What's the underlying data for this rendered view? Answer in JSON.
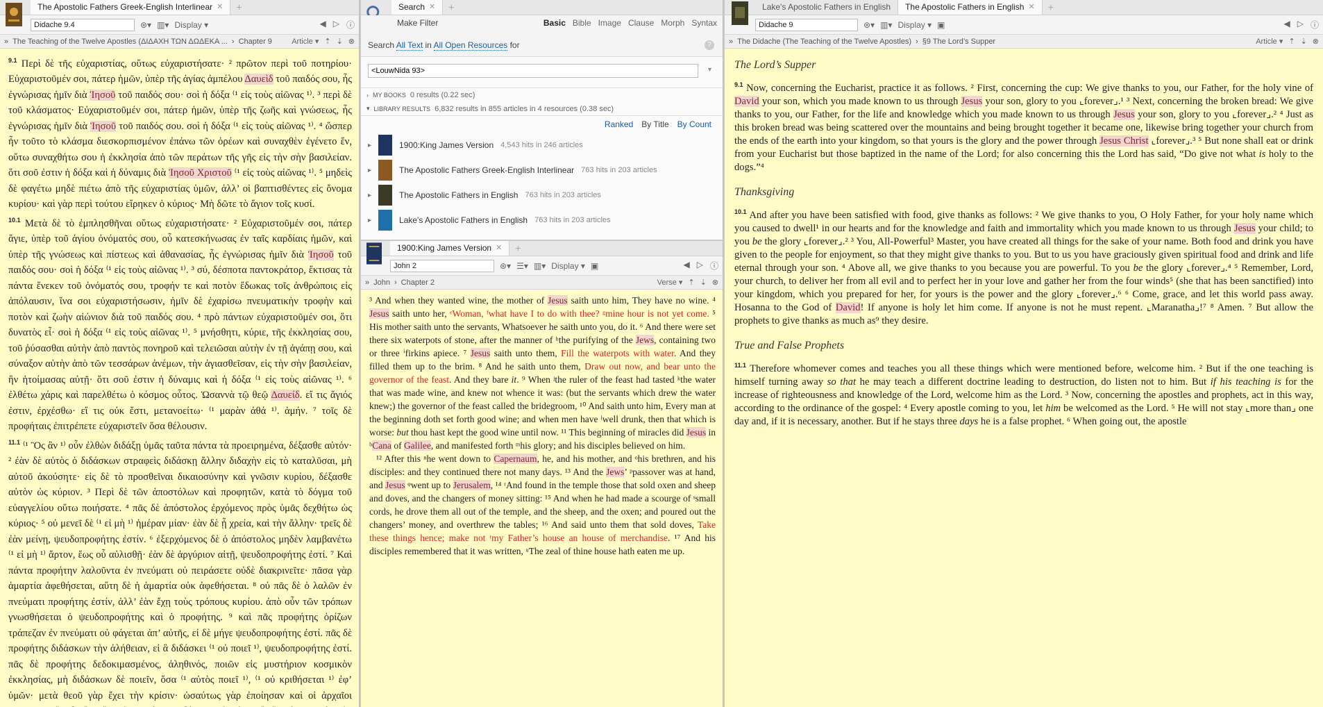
{
  "left": {
    "tab_title": "The Apostolic Fathers Greek-English Interlinear",
    "reference": "Didache 9.4",
    "display_label": "Display",
    "crumb_title": "The Teaching of the Twelve Apostles (ΔΙΔΑΧΗ ΤΩΝ ΔΩΔΕΚΑ ...",
    "crumb_chapter": "Chapter 9",
    "view_label": "Article",
    "paras": [
      {
        "num": "9.1",
        "html": "Περὶ δὲ τῆς εὐχαριστίας, οὕτως εὐχαριστήσατε· ² πρῶτον περὶ τοῦ ποτηρίου· Εὐχαριστοῦμέν σοι, πάτερ ἡμῶν, ὑπὲρ τῆς ἁγίας ἀμπέλου <span class='hl'>Δαυεὶδ</span> τοῦ παιδός σου, ἧς ἐγνώρισας ἡμῖν διὰ <span class='hl'>Ἰησοῦ</span> τοῦ παιδός σου· σοὶ ἡ δόξα ⁽¹ εἰς τοὺς αἰῶνας ¹⁾. ³ περὶ δὲ τοῦ κλάσματος· Εὐχαριστοῦμέν σοι, πάτερ ἡμῶν, ὑπὲρ τῆς ζωῆς καὶ γνώσεως, ἧς ἐγνώρισας ἡμῖν διὰ <span class='hl'>Ἰησοῦ</span> τοῦ παιδός σου. σοὶ ἡ δόξα ⁽¹ εἰς τοὺς αἰῶνας ¹⁾. ⁴ ὥσπερ ἦν τοῦτο τὸ κλάσμα διεσκορπισμένον ἐπάνω τῶν ὀρέων καὶ συναχθὲν ἐγένετο ἕν, οὕτω συναχθήτω σου ἡ ἐκκλησία ἀπὸ τῶν περάτων τῆς γῆς εἰς τὴν σὴν βασιλείαν. ὅτι σοῦ ἐστιν ἡ δόξα καὶ ἡ δύναμις διὰ <span class='hl'>Ἰησοῦ Χριστοῦ</span> ⁽¹ εἰς τοὺς αἰῶνας ¹⁾. ⁵ μηδεὶς δὲ φαγέτω μηδὲ πιέτω ἀπὸ τῆς εὐχαριστίας ὑμῶν, ἀλλ’ οἱ βαπτισθέντες εἰς ὄνομα κυρίου· καὶ γὰρ περὶ τούτου εἴρηκεν ὁ κύριος· Μὴ δῶτε τὸ ἅγιον τοῖς κυσί."
      },
      {
        "num": "10.1",
        "html": "Μετὰ δὲ τὸ ἐμπλησθῆναι οὕτως εὐχαριστήσατε· ² Εὐχαριστοῦμέν σοι, πάτερ ἅγιε, ὑπὲρ τοῦ ἁγίου ὀνόματός σου, οὗ κατεσκήνωσας ἐν ταῖς καρδίαις ἡμῶν, καὶ ὑπὲρ τῆς γνώσεως καὶ πίστεως καὶ ἀθανασίας, ἧς ἐγνώρισας ἡμῖν διὰ <span class='hl'>Ἰησοῦ</span> τοῦ παιδός σου· σοὶ ἡ δόξα ⁽¹ εἰς τοὺς αἰῶνας ¹⁾. ³ σύ, δέσποτα παντοκράτορ, ἔκτισας τὰ πάντα ἕνεκεν τοῦ ὀνόματός σου, τροφήν τε καὶ ποτὸν ἔδωκας τοῖς ἀνθρώποις εἰς ἀπόλαυσιν, ἵνα σοι εὐχαριστήσωσιν, ἡμῖν δὲ ἐχαρίσω πνευματικὴν τροφὴν καὶ ποτὸν καὶ ζωὴν αἰώνιον διὰ τοῦ παιδός σου. ⁴ πρὸ πάντων εὐχαριστοῦμέν σοι, ὅτι δυνατὸς εἶ· σοὶ ἡ δόξα ⁽¹ εἰς τοὺς αἰῶνας ¹⁾. ⁵ μνήσθητι, κύριε, τῆς ἐκκλησίας σου, τοῦ ῥύσασθαι αὐτὴν ἀπὸ παντὸς πονηροῦ καὶ τελειῶσαι αὐτὴν ἐν τῇ ἀγάπῃ σου, καὶ σύναξον αὐτὴν ἀπὸ τῶν τεσσάρων ἀνέμων, τὴν ἁγιασθεῖσαν, εἰς τὴν σὴν βασιλείαν, ἣν ἡτοίμασας αὐτῇ· ὅτι σοῦ ἐστιν ἡ δύναμις καὶ ἡ δόξα ⁽¹ εἰς τοὺς αἰῶνας ¹⁾. ⁶ ἐλθέτω χάρις καὶ παρελθέτω ὁ κόσμος οὗτος. Ὡσαννὰ τῷ θεῷ <span class='hl'>Δαυείδ</span>. εἴ τις ἅγιός ἐστιν, ἐρχέσθω· εἴ τις οὐκ ἔστι, μετανοείτω· ⁽¹ μαρὰν ἀθά ¹⁾. ἀμήν. ⁷ τοῖς δὲ προφήταις ἐπιτρέπετε εὐχαριστεῖν ὅσα θέλουσιν."
      },
      {
        "num": "11.1",
        "html": "⁽¹ Ὃς ἂν ¹⁾ οὖν ἐλθὼν διδάξῃ ὑμᾶς ταῦτα πάντα τὰ προειρημένα, δέξασθε αὐτόν· ² ἐὰν δὲ αὐτὸς ὁ διδάσκων στραφεὶς διδάσκῃ ἄλλην διδαχὴν εἰς τὸ καταλῦσαι, μὴ αὐτοῦ ἀκούσητε· εἰς δὲ τὸ προσθεῖναι δικαιοσύνην καὶ γνῶσιν κυρίου, δέξασθε αὐτὸν ὡς κύριον. ³ Περὶ δὲ τῶν ἀποστόλων καὶ προφητῶν, κατὰ τὸ δόγμα τοῦ εὐαγγελίου οὕτω ποιήσατε. ⁴ πᾶς δὲ ἀπόστολος ἐρχόμενος πρὸς ὑμᾶς δεχθήτω ὡς κύριος· ⁵ οὐ μενεῖ δὲ ⁽¹ εἰ μὴ ¹⁾ ἡμέραν μίαν· ἐὰν δὲ ᾖ χρεία, καὶ τὴν ἄλλην· τρεῖς δὲ ἐὰν μείνῃ, ψευδοπροφήτης ἐστίν. ⁶ ἐξερχόμενος δὲ ὁ ἀπόστολος μηδὲν λαμβανέτω ⁽¹ εἰ μὴ ¹⁾ ἄρτον, ἕως οὗ αὐλισθῇ· ἐὰν δὲ ἀργύριον αἰτῇ, ψευδοπροφήτης ἐστί. ⁷ Καὶ πάντα προφήτην λαλοῦντα ἐν πνεύματι οὐ πειράσετε οὐδὲ διακρινεῖτε· πᾶσα γὰρ ἁμαρτία ἀφεθήσεται, αὕτη δὲ ἡ ἁμαρτία οὐκ ἀφεθήσεται. ⁸ οὐ πᾶς δὲ ὁ λαλῶν ἐν πνεύματι προφήτης ἐστίν, ἀλλ’ ἐὰν ἔχῃ τοὺς τρόπους κυρίου. ἀπὸ οὖν τῶν τρόπων γνωσθήσεται ὁ ψευδοπροφήτης καὶ ὁ προφήτης. ⁹ καὶ πᾶς προφήτης ὁρίζων τράπεζαν ἐν πνεύματι οὐ φάγεται ἀπ’ αὐτῆς, εἰ δὲ μήγε ψευδοπροφήτης ἐστί. πᾶς δὲ προφήτης διδάσκων τὴν ἀλήθειαν, εἰ ἃ διδάσκει ⁽¹ οὐ ποιεῖ ¹⁾, ψευδοπροφήτης ἐστί. πᾶς δὲ προφήτης δεδοκιμασμένος, ἀληθινός, ποιῶν εἰς μυστήριον κοσμικὸν ἐκκλησίας, μὴ διδάσκων δὲ ποιεῖν, ὅσα ⁽¹ αὐτὸς ποιεῖ ¹⁾, ⁽¹ οὐ κριθήσεται ¹⁾ ἐφ’ ὑμῶν· μετὰ θεοῦ γὰρ ἔχει τὴν κρίσιν· ὡσαύτως γὰρ ἐποίησαν καὶ οἱ ἀρχαῖοι προφῆται. ὃς δ’ ἂν εἴπῃ ἐν πνεύματι· δός μοι ἀργύρια ἢ ἕτερά τινα, ⁽¹ οὐκ ἀκούσεσθε ¹⁾ αὐτοῦ"
      }
    ]
  },
  "search": {
    "tab_title": "Search",
    "make_filter": "Make Filter",
    "kinds": [
      "Basic",
      "Bible",
      "Image",
      "Clause",
      "Morph",
      "Syntax"
    ],
    "line_prefix": "Search",
    "line_all_text": "All Text",
    "line_in": "in",
    "line_all_open": "All Open Resources",
    "line_for": "for",
    "query": "<LouwNida 93>",
    "my_books": "MY BOOKS",
    "my_books_count": "0 results (0.22 sec)",
    "library_results": "LIBRARY RESULTS",
    "library_count": "6,832 results in 855 articles in 4 resources (0.38 sec)",
    "sort": [
      "Ranked",
      "By Title",
      "By Count"
    ],
    "results": [
      {
        "title": "1900:King James Version",
        "hits": "4,543 hits in 246 articles"
      },
      {
        "title": "The Apostolic Fathers Greek-English Interlinear",
        "hits": "763 hits in 203 articles"
      },
      {
        "title": "The Apostolic Fathers in English",
        "hits": "763 hits in 203 articles"
      },
      {
        "title": "Lake's Apostolic Fathers in English",
        "hits": "763 hits in 203 articles"
      }
    ]
  },
  "kjv": {
    "tab_title": "1900:King James Version",
    "reference": "John 2",
    "display_label": "Display",
    "crumb_book": "John",
    "crumb_chapter": "Chapter 2",
    "view_label": "Verse",
    "paras": [
      "³ And when they wanted wine, the mother of <span class='hl'>Jesus</span> saith unto him, They have no wine. ⁴ <span class='hl'>Jesus</span> saith unto her, <span class='red'>ᵉWoman, ᶠwhat have I to do with thee? ᵍmine hour is not yet come.</span> ⁵ His mother saith unto the servants, Whatsoever he saith unto you, do it. ⁶ And there were set there six waterpots of stone, after the manner of ʰthe purifying of the <span class='hl'>Jews</span>, containing two or three ⁱfirkins apiece. ⁷ <span class='hl'>Jesus</span> saith unto them, <span class='red'>Fill the waterpots with water</span>. And they filled them up to the brim. ⁸ And he saith unto them, <span class='red'>Draw out now, and bear unto the governor of the feast</span>. And they bare <i>it</i>. ⁹ When ʲthe ruler of the feast had tasted ᵏthe water that was made wine, and knew not whence it was: (but the servants which drew the water knew;) the governor of the feast called the bridegroom, ¹⁰ And saith unto him, Every man at the beginning doth set forth good wine; and when men have ˡwell drunk, then that which is worse: <i>but</i> thou hast kept the good wine until now. ¹¹ This beginning of miracles did <span class='hl'>Jesus</span> in ᵇ<span class='hl'>Cana</span> of <span class='hl'>Galilee</span>, and manifested forth ᵐhis glory; and his disciples believed on him.",
      "¹² After this ⁿhe went down to <span class='hl'>Capernaum</span>, he, and his mother, and ᵒhis brethren, and his disciples: and they continued there not many days. ¹³ And the <span class='hl'>Jews</span>’ ᵖpassover was at hand, and <span class='hl'>Jesus</span> ᵠwent up to <span class='hl'>Jerusalem</span>, ¹⁴ ʳAnd found in the temple those that sold oxen and sheep and doves, and the changers of money sitting: ¹⁵ And when he had made a scourge of ˢsmall cords, he drove them all out of the temple, and the sheep, and the oxen; and poured out the changers’ money, and overthrew the tables; ¹⁶ And said unto them that sold doves, <span class='red'>Take these things hence; make not ᵗmy Father’s house an house of merchandise</span>. ¹⁷ And his disciples remembered that it was written, ᵘThe zeal of thine house hath eaten me up."
    ]
  },
  "right": {
    "tab1": "Lake's Apostolic Fathers in English",
    "tab2": "The Apostolic Fathers in English",
    "reference": "Didache 9",
    "display_label": "Display",
    "crumb_title": "The Didache (The Teaching of the Twelve Apostles)",
    "crumb_section": "§9 The Lord’s Supper",
    "view_label": "Article",
    "sections": [
      {
        "heading": "The Lord’s Supper",
        "num": "9.1",
        "html": "Now, concerning the Eucharist, practice it as follows. ² First, concerning the cup: We give thanks to you, our Father, for the holy vine of <span class='hl'>David</span> your son, which you made known to us through <span class='hl'>Jesus</span> your son, glory to you ⌞forever⌟.¹ ³ Next, concerning the broken bread: We give thanks to you, our Father, for the life and knowledge which you made known to us through <span class='hl'>Jesus</span> your son, glory to you ⌞forever⌟.² ⁴ Just as this broken bread was being scattered over the mountains and being brought together it became one, likewise bring together your church from the ends of the earth into your kingdom, so that yours is the glory and the power through <span class='hl'>Jesus Christ</span> ⌞forever⌟.³ ⁵ But none shall eat or drink from your Eucharist but those baptized in the name of the Lord; for also concerning this the Lord has said, “Do give not what <i>is</i> holy to the dogs.”⁴"
      },
      {
        "heading": "Thanksgiving",
        "num": "10.1",
        "html": "And after you have been satisfied with food, give thanks as follows: ² We give thanks to you, O Holy Father, for your holy name which you caused to dwell¹ in our hearts and for the knowledge and faith and immortality which you made known to us through <span class='hl'>Jesus</span> your child; to you <i>be</i> the glory ⌞forever⌟.² ³ You, All-Powerful³ Master, you have created all things for the sake of your name. Both food and drink you have given to the people for enjoyment, so that they might give thanks to you. But to us you have graciously given spiritual food and drink and life eternal through your son. ⁴ Above all, we give thanks to you because you are powerful. To you <i>be</i> the glory ⌞forever⌟.⁴ ⁵ Remember, Lord, your church, to deliver her from all evil and to perfect her in your love and gather her from the four winds⁵ (she that has been sanctified) into your kingdom, which you prepared for her, for yours is the power and the glory ⌞forever⌟.⁶ ⁶ Come, grace, and let this world pass away. Hosanna to the God of <span class='hl'>David</span>! If anyone is holy let him come. If anyone is not he must repent. ⌞Maranatha⌟!⁷ ⁸ Amen. ⁷ But allow the prophets to give thanks as much as⁹ they desire."
      },
      {
        "heading": "True and False Prophets",
        "num": "11.1",
        "html": "Therefore whomever comes and teaches you all these things which were mentioned before, welcome him. ² But if the one teaching is himself turning away <i>so that</i> he may teach a different doctrine leading to destruction, do listen not to him. But <i>if his teaching is</i> for the increase of righteousness and knowledge of the Lord, welcome him as the Lord. ³ Now, concerning the apostles and prophets, act in this way, according to the ordinance of the gospel: ⁴ Every apostle coming to you, let <i>him</i> be welcomed as the Lord. ⁵ He will not stay ⌞more than⌟ one day and, if it is necessary, another. But if he stays three <i>days</i> he is a false prophet. ⁶ When going out, the apostle"
      }
    ]
  }
}
